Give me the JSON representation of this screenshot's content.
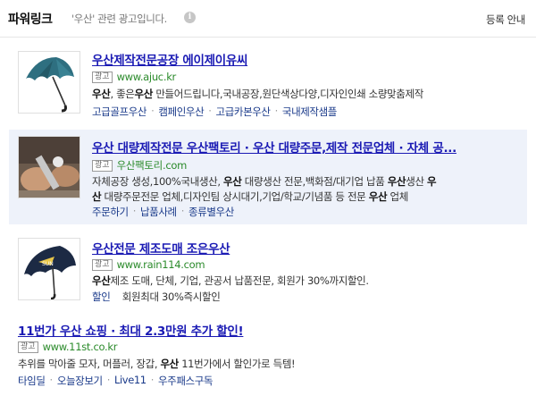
{
  "header": {
    "title": "파워링크",
    "subtitle": "'우산' 관련 광고입니다.",
    "info_icon": "i",
    "register_link": "등록 안내"
  },
  "ad_badge_label": "광고",
  "ads": [
    {
      "title": "우산제작전문공장 에이제이유씨",
      "url": "www.ajuc.kr",
      "description_lines": [
        [
          {
            "t": "우산",
            "b": true
          },
          {
            "t": ", 좋은",
            "b": false
          },
          {
            "t": "우산",
            "b": true
          },
          {
            "t": " 만들어드립니다,국내공장,원단색상다양,디자인인쇄 소량맞춤제작",
            "b": false
          }
        ]
      ],
      "links": [
        "고급골프우산",
        "캠페인우산",
        "고급카본우산",
        "국내제작샘플"
      ],
      "image": "green-umbrella"
    },
    {
      "title": "우산 대량제작전문 우산팩토리 · 우산 대량주문,제작 전문업체 · 자체 공...",
      "url": "우산팩토리.com",
      "description_lines": [
        [
          {
            "t": "자체공장 생성,100%국내생산, ",
            "b": false
          },
          {
            "t": "우산",
            "b": true
          },
          {
            "t": " 대량생산 전문,백화점/대기업 납품 ",
            "b": false
          },
          {
            "t": "우산",
            "b": true
          },
          {
            "t": "생산 ",
            "b": false
          },
          {
            "t": "우",
            "b": true
          }
        ],
        [
          {
            "t": "산",
            "b": true
          },
          {
            "t": " 대량주문전문 업체,디자인팀 상시대기,기업/학교/기념품 등 전문 ",
            "b": false
          },
          {
            "t": "우산",
            "b": true
          },
          {
            "t": " 업체",
            "b": false
          }
        ]
      ],
      "links": [
        "주문하기",
        "납품사례",
        "종류별우산"
      ],
      "image": "umbrella-factory-hands"
    },
    {
      "title": "우산전문 제조도매 조은우산",
      "url": "www.rain114.com",
      "description_lines": [
        [
          {
            "t": "우산",
            "b": true
          },
          {
            "t": "제조 도매, 단체, 기업, 관공서 납품전문, 회원가 30%까지할인.",
            "b": false
          }
        ]
      ],
      "promo": {
        "label": "할인",
        "text": "회원최대 30%즉시할인"
      },
      "image": "navy-umbrella"
    },
    {
      "title": "11번가 우산 쇼핑 · 최대 2.3만원 추가 할인!",
      "url": "www.11st.co.kr",
      "description_lines": [
        [
          {
            "t": "추위를 막아줄 모자, 머플러, 장갑, ",
            "b": false
          },
          {
            "t": "우산",
            "b": true
          },
          {
            "t": " 11번가에서 할인가로 득템!",
            "b": false
          }
        ]
      ],
      "links": [
        "타임딜",
        "오늘장보기",
        "Live11",
        "우주패스구독"
      ]
    }
  ],
  "colors": {
    "title_link": "#1a1ab4",
    "url": "#2a8a2a",
    "sub_link": "#1a3a8a",
    "highlight_bg": "#eef2fa"
  }
}
